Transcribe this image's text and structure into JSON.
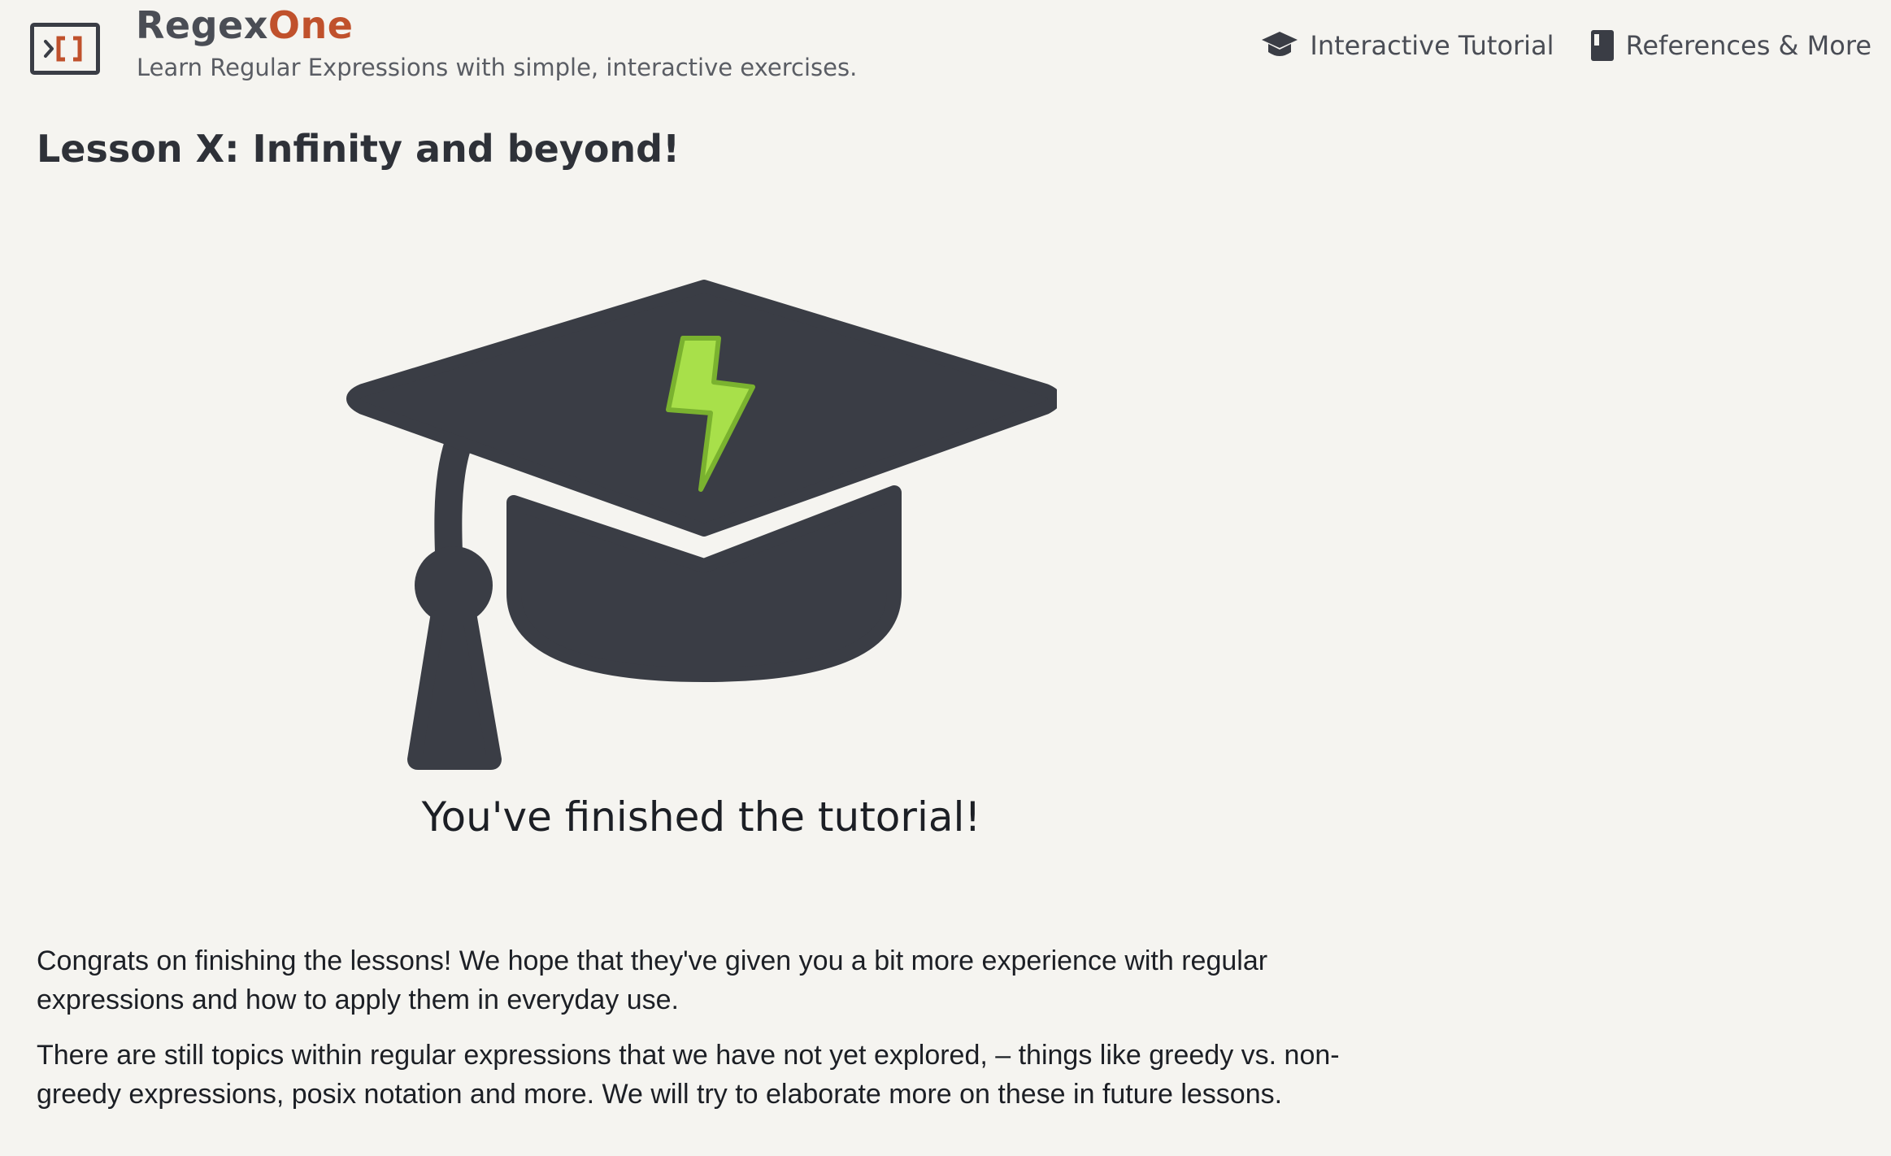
{
  "header": {
    "logo_icon": "regex-terminal-icon",
    "brand_primary": "Regex",
    "brand_accent": "One",
    "tagline": "Learn Regular Expressions with simple, interactive exercises."
  },
  "nav": {
    "items": [
      {
        "label": "Interactive Tutorial",
        "icon": "graduation-cap-icon"
      },
      {
        "label": "References & More",
        "icon": "book-icon"
      }
    ]
  },
  "main": {
    "lesson_title": "Lesson X: Infinity and beyond!",
    "hero_icon": "graduation-cap-lightning-icon",
    "finished_heading": "You've finished the tutorial!",
    "paragraphs": [
      "Congrats on finishing the lessons! We hope that they've given you a bit more experience with regular expressions and how to apply them in everyday use.",
      "There are still topics within regular expressions that we have not yet explored, – things like greedy vs. non-greedy expressions, posix notation and more. We will try to elaborate more on these in future lessons."
    ]
  },
  "colors": {
    "background": "#f5f4f0",
    "brand_accent": "#c0512c",
    "icon_dark": "#3a3d45",
    "lightning_green": "#a8e04a"
  }
}
